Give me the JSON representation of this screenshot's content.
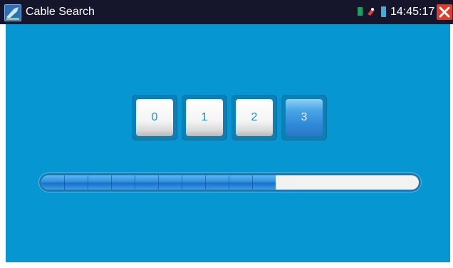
{
  "window": {
    "title": "Cable Search",
    "app_icon": "cable-tester-app-icon",
    "time": "14:45:17",
    "status_icons": [
      "sim-icon",
      "link-icon",
      "battery-icon"
    ],
    "close_icon": "close-icon"
  },
  "digits": [
    {
      "label": "0",
      "active": false
    },
    {
      "label": "1",
      "active": false
    },
    {
      "label": "2",
      "active": false
    },
    {
      "label": "3",
      "active": true
    }
  ],
  "progress": {
    "fraction": 0.62,
    "segments": 10
  },
  "colors": {
    "titlebar": "#15152c",
    "background": "#0696d2",
    "digit_text": "#1b8fd0",
    "active_digit": "#2f88d8",
    "close_button": "#e03a2a"
  }
}
